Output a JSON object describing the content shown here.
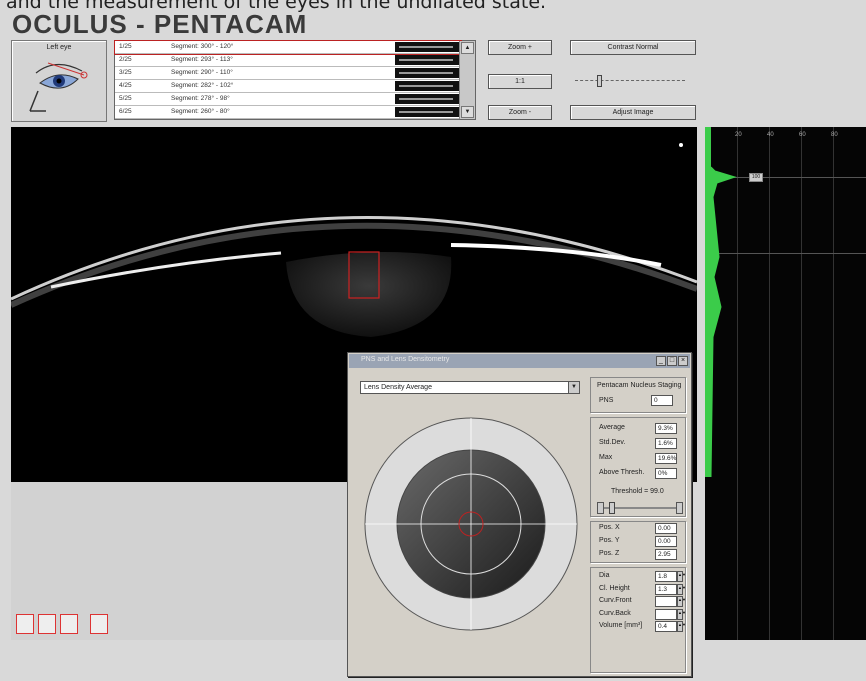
{
  "caption": "and the measurement of the eyes in the undilated state.",
  "app": {
    "title": "OCULUS  -  PENTACAM"
  },
  "thumbnail": {
    "label": "Left eye",
    "icon": "eye-scan-icon"
  },
  "segments": [
    {
      "index": "1/25",
      "text": "Segment: 300° - 120°",
      "selected": true
    },
    {
      "index": "2/25",
      "text": "Segment: 293° - 113°",
      "selected": false
    },
    {
      "index": "3/25",
      "text": "Segment: 290° - 110°",
      "selected": false
    },
    {
      "index": "4/25",
      "text": "Segment: 282° - 102°",
      "selected": false
    },
    {
      "index": "5/25",
      "text": "Segment: 278° - 98°",
      "selected": false
    },
    {
      "index": "6/25",
      "text": "Segment: 260° - 80°",
      "selected": false
    }
  ],
  "buttons": {
    "zoom_in": "Zoom +",
    "one_to_one": "1:1",
    "zoom_out": "Zoom -",
    "contrast": "Contrast Normal",
    "adjust": "Adjust Image"
  },
  "right_panel": {
    "axis_ticks": [
      "20",
      "40",
      "60",
      "80"
    ],
    "marker_label": "100"
  },
  "dialog": {
    "title": "PNS and Lens Densitometry",
    "select_value": "Lens Density Average",
    "staging": {
      "header": "Pentacam Nucleus Staging",
      "label": "PNS",
      "value": "0"
    },
    "stats": [
      {
        "label": "Average",
        "value": "9.3%"
      },
      {
        "label": "Std.Dev.",
        "value": "1.6%"
      },
      {
        "label": "Max",
        "value": "19.6%"
      },
      {
        "label": "Above Thresh.",
        "value": "0%"
      }
    ],
    "threshold_label": "Threshold = 99.0",
    "positions": [
      {
        "label": "Pos. X",
        "value": "0.00"
      },
      {
        "label": "Pos. Y",
        "value": "0.00"
      },
      {
        "label": "Pos. Z",
        "value": "2.95"
      }
    ],
    "geometry": [
      {
        "label": "Dia",
        "value": "1.8"
      },
      {
        "label": "Cl. Height",
        "value": "1.3"
      },
      {
        "label": "Curv.Front",
        "value": ""
      },
      {
        "label": "Curv.Back",
        "value": ""
      },
      {
        "label": "Volume [mm³]",
        "value": "0.4"
      }
    ]
  },
  "colors": {
    "window_bg": "#d9d9d9",
    "dialog_bg": "#d4d0c8",
    "accent_red": "#b22222",
    "histogram_green": "#3bcc4a"
  }
}
